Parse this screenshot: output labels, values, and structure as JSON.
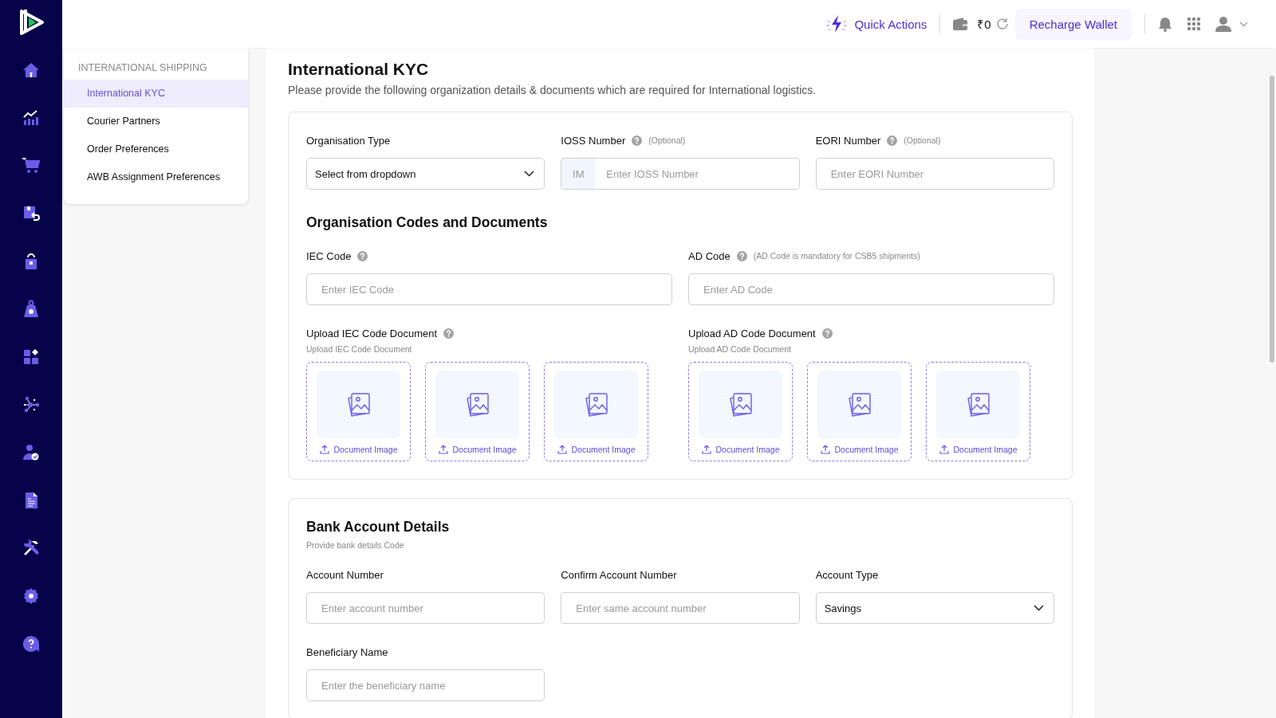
{
  "top_bar": {
    "quick_actions": "Quick Actions",
    "balance": "₹0",
    "recharge_button": "Recharge Wallet"
  },
  "settings_nav": {
    "heading": "INTERNATIONAL SHIPPING",
    "items": [
      {
        "label": "International KYC",
        "selected": true
      },
      {
        "label": "Courier Partners",
        "selected": false
      },
      {
        "label": "Order Preferences",
        "selected": false
      },
      {
        "label": "AWB Assignment Preferences",
        "selected": false
      }
    ]
  },
  "page": {
    "title": "International KYC",
    "subtitle": "Please provide the following organization details & documents which are required for International logistics."
  },
  "organisation": {
    "fields": [
      {
        "kind": "select",
        "label": "Organisation Type",
        "help": false,
        "value": "Select from dropdown"
      },
      {
        "kind": "prefixed",
        "label": "IOSS Number",
        "help": true,
        "note": "(Optional)",
        "prefix": "IM",
        "placeholder": "Enter IOSS Number"
      },
      {
        "kind": "text",
        "label": "EORI Number",
        "help": true,
        "note": "(Optional)",
        "placeholder": "Enter EORI Number"
      }
    ]
  },
  "codes": {
    "heading": "Organisation Codes and Documents",
    "fields": [
      {
        "kind": "text",
        "label": "IEC Code",
        "help": true,
        "placeholder": "Enter IEC Code"
      },
      {
        "kind": "text",
        "label": "AD Code",
        "help": true,
        "note": "(AD Code is mandatory for CSB5 shipments)",
        "placeholder": "Enter AD Code"
      }
    ],
    "uploads": [
      {
        "label": "Upload IEC Code Document",
        "help": true,
        "hint": "Upload IEC Code Document",
        "slots": [
          "Document Image",
          "Document Image",
          "Document Image"
        ]
      },
      {
        "label": "Upload AD Code Document",
        "help": true,
        "hint": "Upload AD Code Document",
        "slots": [
          "Document Image",
          "Document Image",
          "Document Image"
        ]
      }
    ]
  },
  "bank": {
    "heading": "Bank Account Details",
    "subtitle": "Provide bank details Code",
    "fields": [
      {
        "kind": "text",
        "label": "Account Number",
        "help": false,
        "placeholder": "Enter account number"
      },
      {
        "kind": "text",
        "label": "Confirm Account Number",
        "help": false,
        "placeholder": "Enter same account number"
      },
      {
        "kind": "select",
        "label": "Account Type",
        "help": false,
        "value": "Savings"
      },
      {
        "kind": "text",
        "label": "Beneficiary Name",
        "help": false,
        "placeholder": "Enter the beneficiary name"
      }
    ]
  }
}
